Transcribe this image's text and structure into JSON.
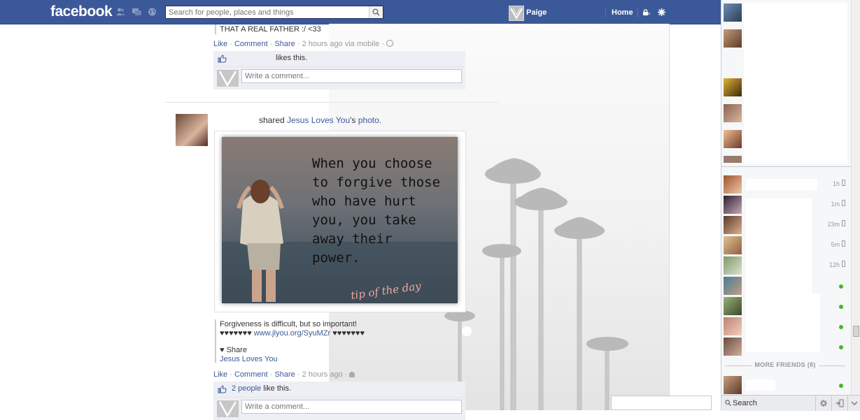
{
  "header": {
    "logo": "facebook",
    "search_placeholder": "Search for people, places and things",
    "profile_name": "Paige",
    "home_label": "Home"
  },
  "post1": {
    "message": "THAT A REAL FATHER :/ <33",
    "actions": {
      "like": "Like",
      "comment": "Comment",
      "share": "Share",
      "meta": "2 hours ago via mobile"
    },
    "likes_text": "likes this.",
    "comment_placeholder": "Write a comment..."
  },
  "post2": {
    "shared_prefix": "shared",
    "shared_page": "Jesus Loves You",
    "shared_suffix": "'s",
    "shared_object": "photo.",
    "image_text": "When you choose\nto forgive those\nwho have hurt\nyou, you take\naway their\npower.",
    "image_signature": "tip of the day",
    "caption_line1": "Forgiveness is difficult, but so important!",
    "caption_hearts_left": "♥♥♥♥♥♥♥",
    "caption_link": "www.jlyou.org/SyuMZr",
    "caption_hearts_right": "♥♥♥♥♥♥♥",
    "caption_share": "♥ Share",
    "caption_page": "Jesus Loves You",
    "actions": {
      "like": "Like",
      "comment": "Comment",
      "share": "Share",
      "meta": "2 hours ago"
    },
    "likes_count": "2 people",
    "likes_suffix": "like this.",
    "comment_placeholder": "Write a comment..."
  },
  "sidebar": {
    "friends": [
      {
        "time": "1h",
        "status": "mobile"
      },
      {
        "time": "1m",
        "status": "mobile"
      },
      {
        "time": "23m",
        "status": "mobile"
      },
      {
        "time": "5m",
        "status": "mobile"
      },
      {
        "time": "12h",
        "status": "mobile"
      },
      {
        "time": "",
        "status": "online"
      },
      {
        "time": "",
        "status": "online"
      },
      {
        "time": "",
        "status": "online"
      },
      {
        "time": "",
        "status": "online"
      }
    ],
    "more_friends_label": "MORE FRIENDS (8)",
    "chat_search_label": "Search"
  },
  "colors": {
    "brand": "#3b5998",
    "online": "#42b72a"
  }
}
